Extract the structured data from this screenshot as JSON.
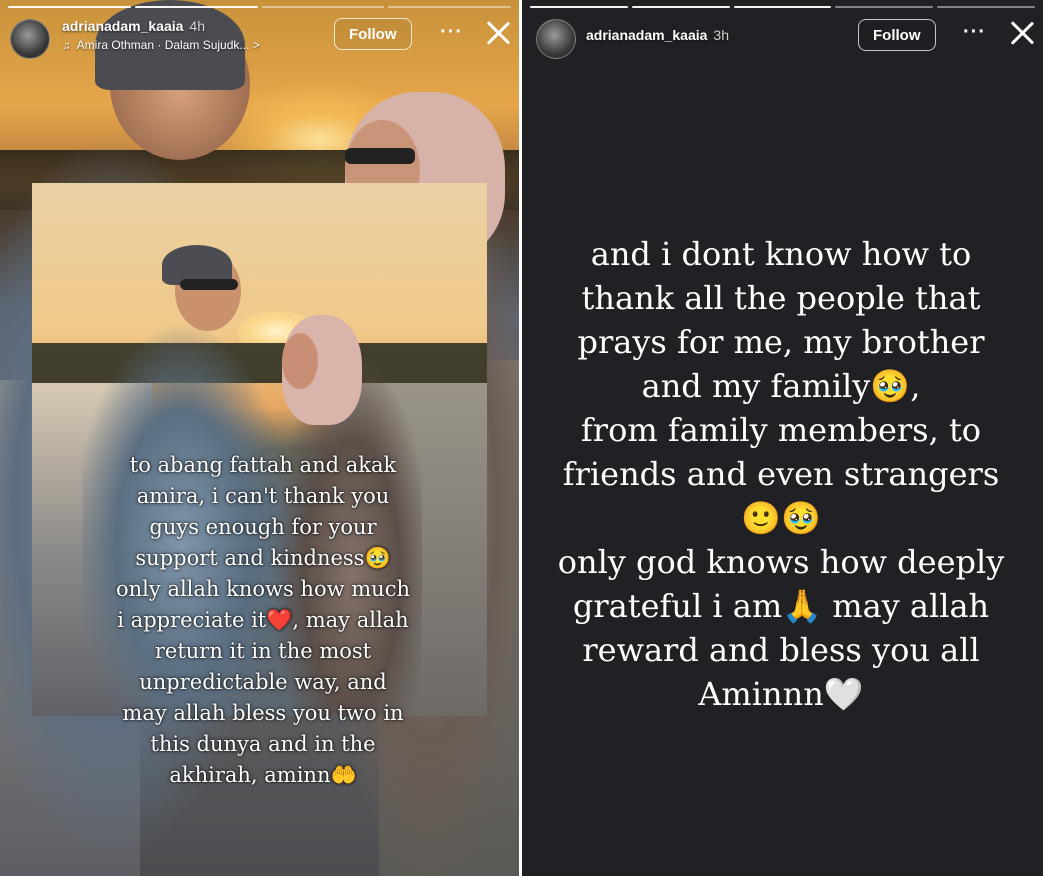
{
  "left_story": {
    "username": "adrianadam_kaaia",
    "time": "4h",
    "music_label": "Amira Othman · Dalam Sujudk...",
    "music_chevron": ">",
    "follow_label": "Follow",
    "more_label": "···",
    "caption": "to abang fattah and akak\namira, i can't thank you\nguys enough for your\nsupport and kindness🥹\nonly allah knows how much\ni appreciate it❤️, may allah\nreturn it in the most\nunpredictable way, and\nmay allah bless you two in\nthis dunya and in the\nakhirah, aminn🤲"
  },
  "right_story": {
    "username": "adrianadam_kaaia",
    "time": "3h",
    "follow_label": "Follow",
    "more_label": "···",
    "caption": "and i dont know how to\nthank all the people that\nprays for me, my brother\nand my family🥹,\nfrom family members, to\nfriends and even strangers\n🙂🥹\nonly god knows how deeply\ngrateful i am🙏 may allah\nreward and bless you all\nAminnn🤍"
  },
  "colors": {
    "dark_bg": "#202124",
    "text": "#ffffff"
  }
}
